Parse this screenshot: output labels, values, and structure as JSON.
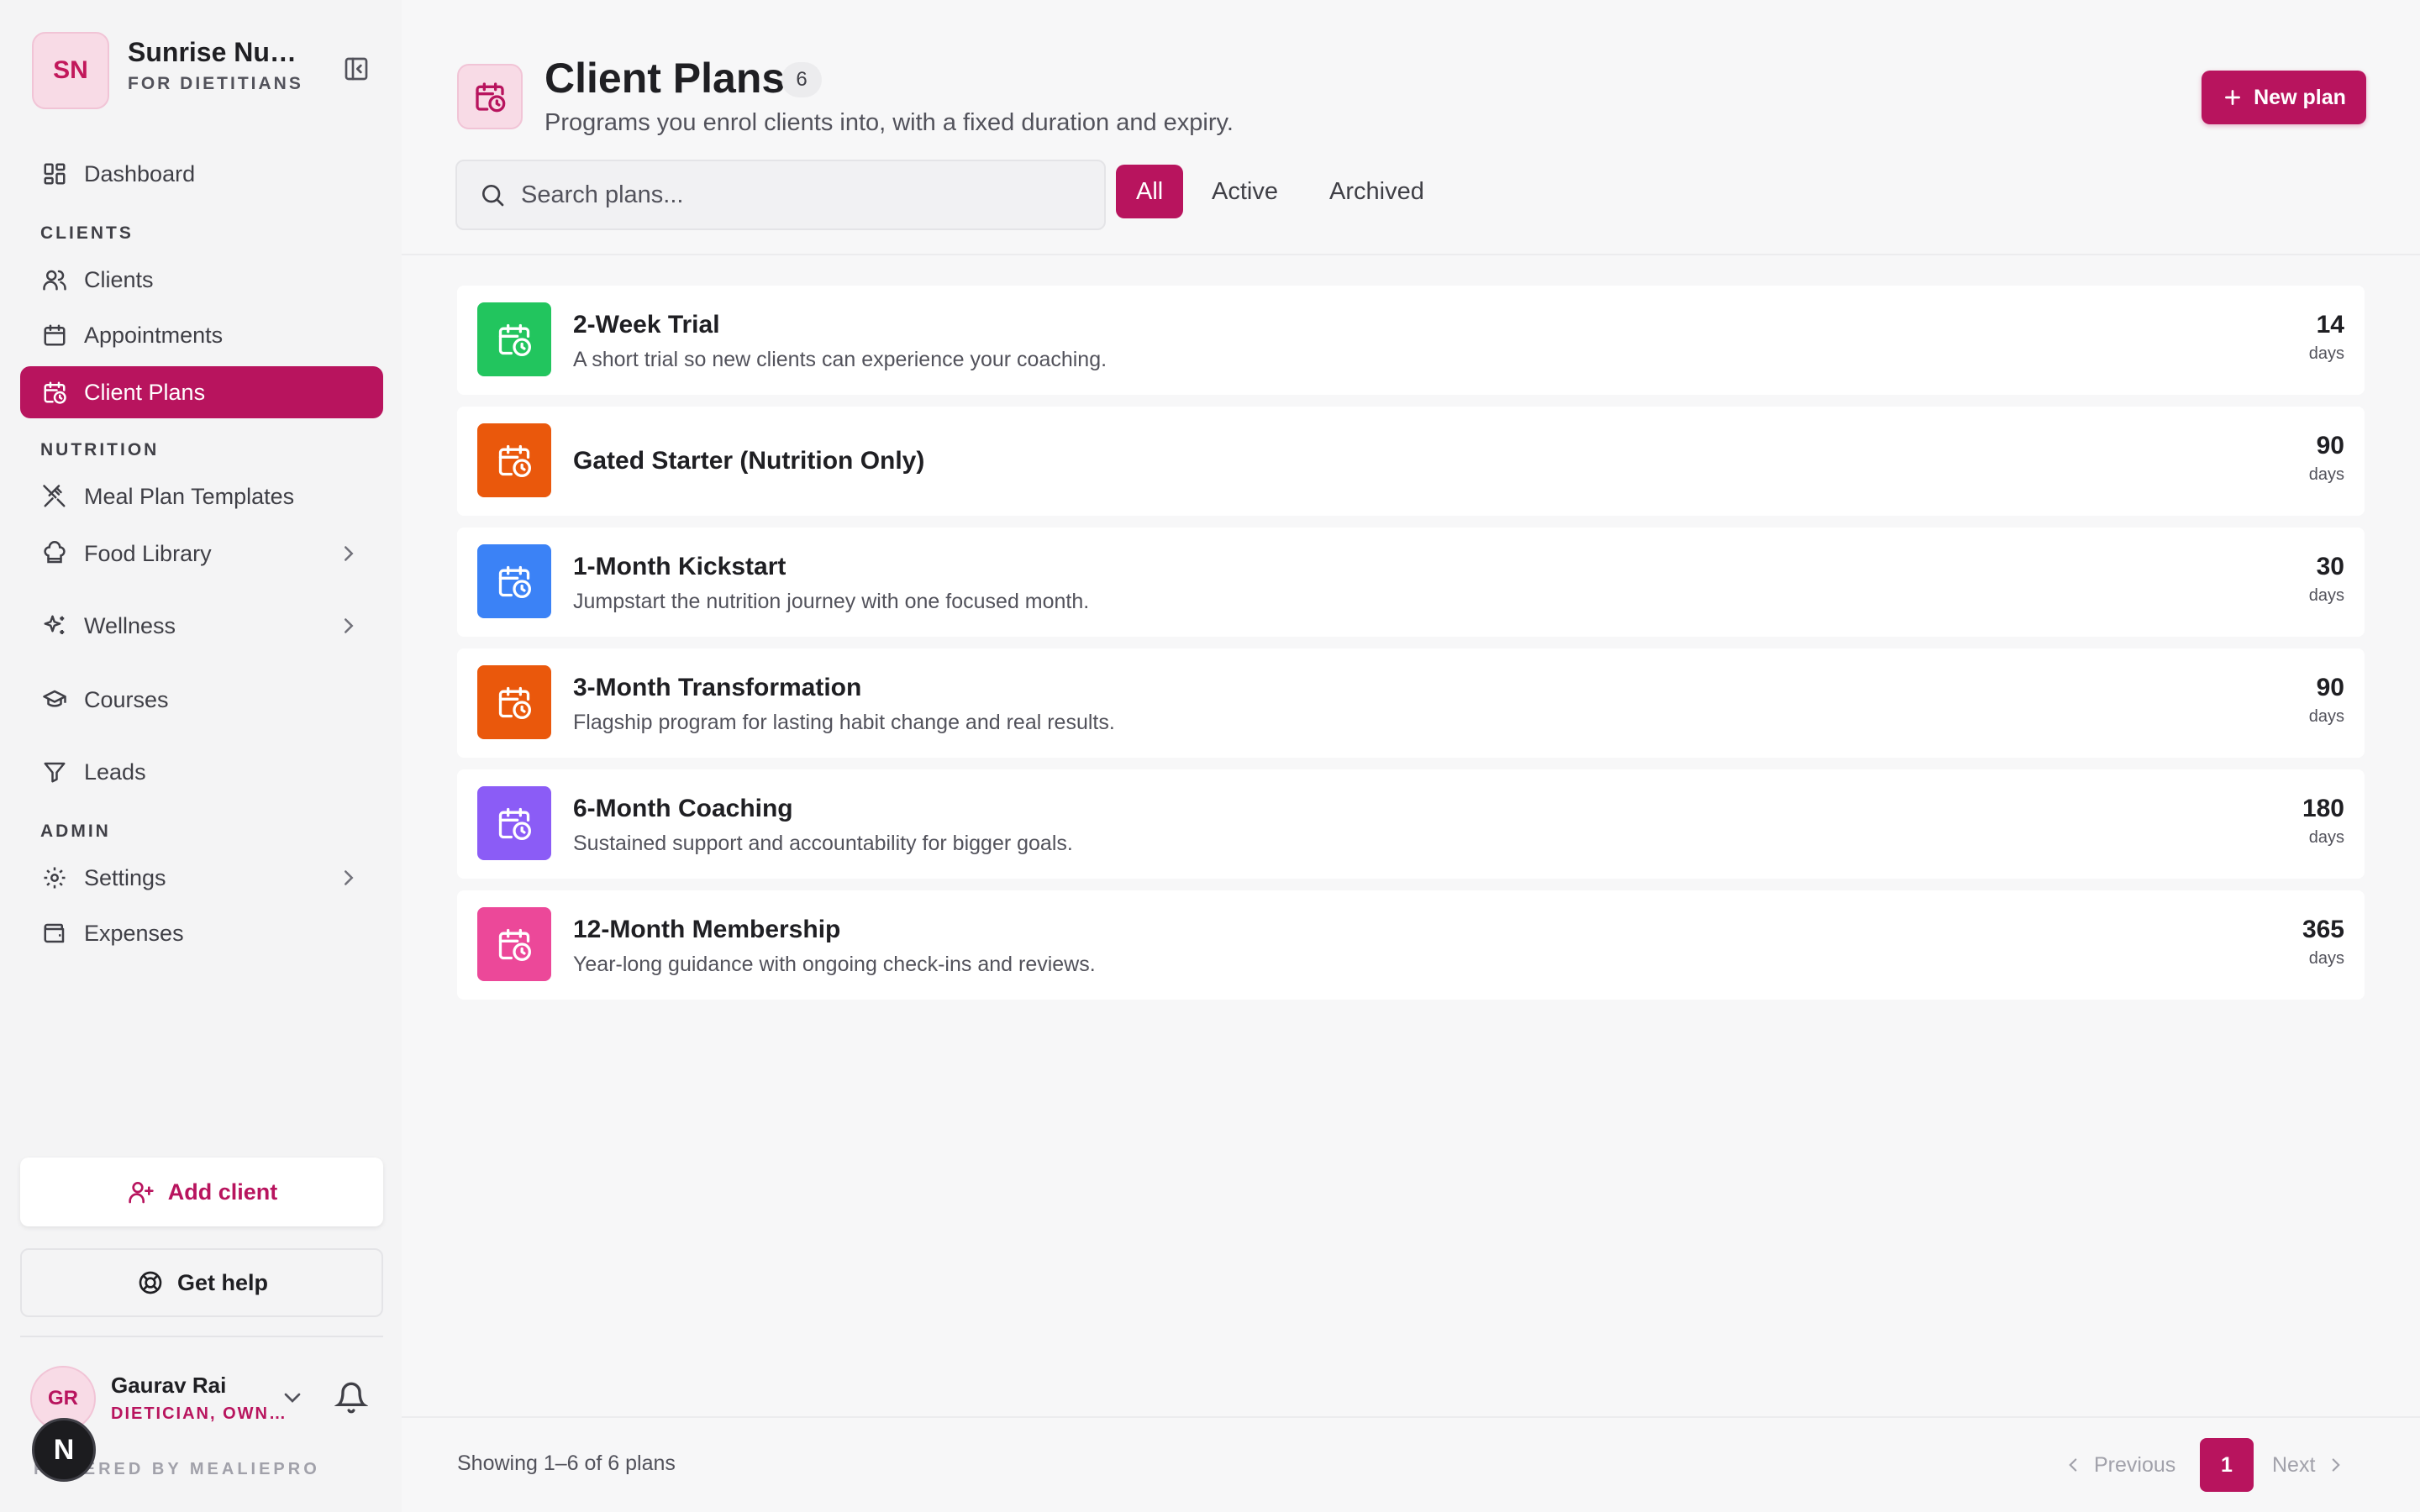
{
  "brand": {
    "initials": "SN",
    "name": "Sunrise Nutrition",
    "subtitle": "FOR DIETITIANS"
  },
  "nav": {
    "dashboard": "Dashboard",
    "section_clients": "CLIENTS",
    "clients": "Clients",
    "appointments": "Appointments",
    "client_plans": "Client Plans",
    "section_nutrition": "NUTRITION",
    "meal_plan_templates": "Meal Plan Templates",
    "food_library": "Food Library",
    "wellness": "Wellness",
    "courses": "Courses",
    "leads": "Leads",
    "section_admin": "ADMIN",
    "settings": "Settings",
    "expenses": "Expenses"
  },
  "sidebar_actions": {
    "add_client": "Add client",
    "get_help": "Get help"
  },
  "user": {
    "initials": "GR",
    "name": "Gaurav Rai",
    "role": "DIETICIAN, OWNER"
  },
  "powered_by": "POWERED BY MEALIEPRO",
  "n_badge": "N",
  "header": {
    "title": "Client Plans",
    "count": "6",
    "subtitle": "Programs you enrol clients into, with a fixed duration and expiry.",
    "new_plan": "New plan"
  },
  "search": {
    "placeholder": "Search plans..."
  },
  "filters": {
    "all": "All",
    "active": "Active",
    "archived": "Archived"
  },
  "plans": [
    {
      "name": "2-Week Trial",
      "description": "A short trial so new clients can experience your coaching.",
      "days": "14",
      "unit": "days",
      "color": "#22c55e"
    },
    {
      "name": "Gated Starter (Nutrition Only)",
      "description": "",
      "days": "90",
      "unit": "days",
      "color": "#ea580c"
    },
    {
      "name": "1-Month Kickstart",
      "description": "Jumpstart the nutrition journey with one focused month.",
      "days": "30",
      "unit": "days",
      "color": "#3b82f6"
    },
    {
      "name": "3-Month Transformation",
      "description": "Flagship program for lasting habit change and real results.",
      "days": "90",
      "unit": "days",
      "color": "#ea580c"
    },
    {
      "name": "6-Month Coaching",
      "description": "Sustained support and accountability for bigger goals.",
      "days": "180",
      "unit": "days",
      "color": "#8b5cf6"
    },
    {
      "name": "12-Month Membership",
      "description": "Year-long guidance with ongoing check-ins and reviews.",
      "days": "365",
      "unit": "days",
      "color": "#ec4899"
    }
  ],
  "pagination": {
    "showing": "Showing 1–6 of 6 plans",
    "previous": "Previous",
    "page": "1",
    "next": "Next"
  },
  "colors": {
    "accent": "#b8145e",
    "accent_light": "#f8dbe6"
  }
}
